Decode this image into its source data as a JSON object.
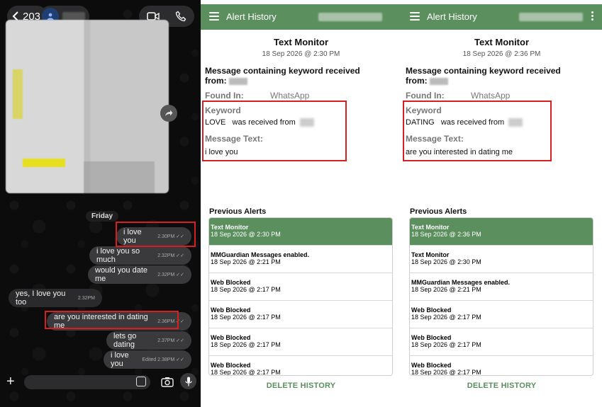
{
  "chat": {
    "back_count": "203",
    "day_label": "Friday",
    "messages": [
      {
        "text": "i love you",
        "time": "2.30PM",
        "ticks": "✓✓"
      },
      {
        "text": "i love you so much",
        "time": "2.32PM",
        "ticks": "✓✓"
      },
      {
        "text": "would you date me",
        "time": "2.32PM",
        "ticks": "✓✓"
      },
      {
        "text": "yes, I love you too",
        "time": "2.32PM",
        "ticks": ""
      },
      {
        "text": "are you interested in dating me",
        "time": "2.36PM",
        "ticks": "✓✓"
      },
      {
        "text": "lets go dating",
        "time": "2.37PM",
        "ticks": "✓✓"
      },
      {
        "text": "i love you",
        "time": "Edited 2.38PM",
        "ticks": "✓✓"
      }
    ]
  },
  "panels": [
    {
      "app_title": "Alert History",
      "detail_title": "Text Monitor",
      "detail_date": "18 Sep 2026 @ 2:30 PM",
      "heading": "Message containing keyword received from:",
      "found_in_label": "Found In:",
      "found_in_value": "WhatsApp",
      "keyword_label": "Keyword",
      "keyword_value": "LOVE",
      "keyword_suffix": "was received from",
      "message_text_label": "Message Text:",
      "message_text_value": "i love you",
      "previous_label": "Previous Alerts",
      "alerts": [
        {
          "title": "Text Monitor",
          "date": "18 Sep 2026 @ 2:30 PM",
          "active": true
        },
        {
          "title": "MMGuardian Messages enabled.",
          "date": "18 Sep 2026 @ 2:21 PM",
          "active": false
        },
        {
          "title": "Web Blocked",
          "date": "18 Sep 2026 @ 2:17 PM",
          "active": false
        },
        {
          "title": "Web Blocked",
          "date": "18 Sep 2026 @ 2:17 PM",
          "active": false
        },
        {
          "title": "Web Blocked",
          "date": "18 Sep 2026 @ 2:17 PM",
          "active": false
        },
        {
          "title": "Web Blocked",
          "date": "18 Sep 2026 @ 2:17 PM",
          "active": false
        }
      ],
      "delete_label": "DELETE HISTORY"
    },
    {
      "app_title": "Alert History",
      "detail_title": "Text Monitor",
      "detail_date": "18 Sep 2026 @ 2:36 PM",
      "heading": "Message containing keyword received from:",
      "found_in_label": "Found In:",
      "found_in_value": "WhatsApp",
      "keyword_label": "Keyword",
      "keyword_value": "DATING",
      "keyword_suffix": "was received from",
      "message_text_label": "Message Text:",
      "message_text_value": "are you interested in dating me",
      "previous_label": "Previous Alerts",
      "alerts": [
        {
          "title": "Text Monitor",
          "date": "18 Sep 2026 @ 2:36 PM",
          "active": true
        },
        {
          "title": "Text Monitor",
          "date": "18 Sep 2026 @ 2:30 PM",
          "active": false
        },
        {
          "title": "MMGuardian Messages enabled.",
          "date": "18 Sep 2026 @ 2:21 PM",
          "active": false
        },
        {
          "title": "Web Blocked",
          "date": "18 Sep 2026 @ 2:17 PM",
          "active": false
        },
        {
          "title": "Web Blocked",
          "date": "18 Sep 2026 @ 2:17 PM",
          "active": false
        },
        {
          "title": "Web Blocked",
          "date": "18 Sep 2026 @ 2:17 PM",
          "active": false
        }
      ],
      "delete_label": "DELETE HISTORY"
    }
  ],
  "colors": {
    "app_green": "#5b8f5d",
    "highlight_red": "#d61f1f"
  }
}
